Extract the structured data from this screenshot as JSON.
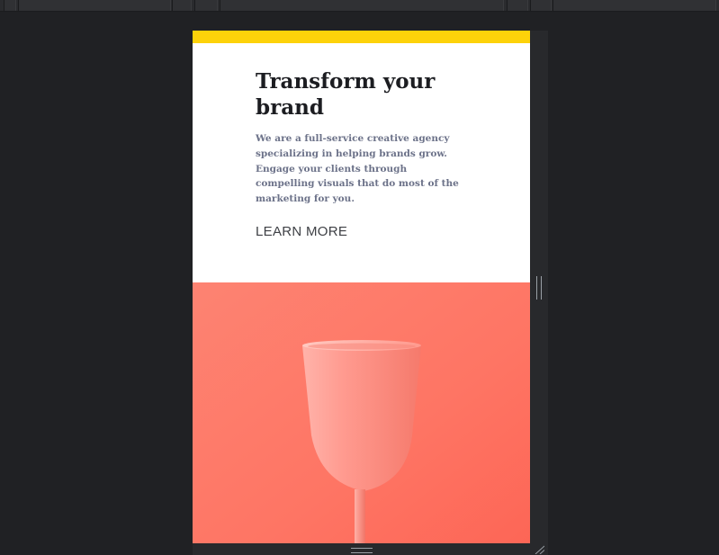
{
  "hero": {
    "title": "Transform your brand",
    "body": "We are a full-service creative agency specializing in helping brands grow. Engage your clients through compelling visuals that do most of the marketing for you.",
    "cta_label": "LEARN MORE"
  },
  "colors": {
    "accent": "#fdd20a",
    "hero_image_bg": "#fd6f5f",
    "cup": "#ff8e82",
    "title": "#1c1d21",
    "body": "#6c7289",
    "cta": "#3e4045"
  },
  "icons": {
    "hero_image": "pink-cup-illustration",
    "right_handle": "vertical-resize-grip-icon",
    "bottom_handle": "horizontal-resize-grip-icon",
    "corner_handle": "corner-resize-grip-icon"
  }
}
